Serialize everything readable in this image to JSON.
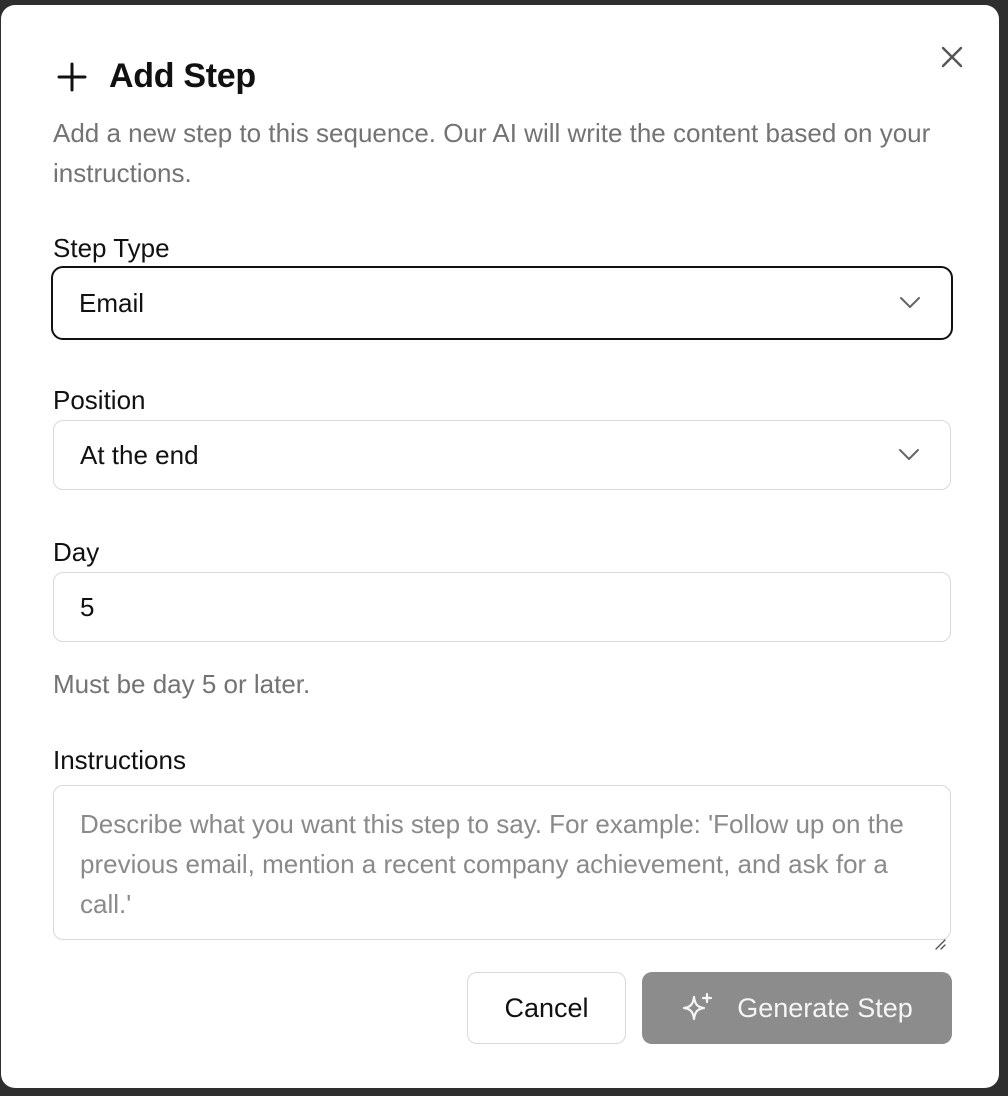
{
  "dialog": {
    "title": "Add Step",
    "description": "Add a new step to this sequence. Our AI will write the content based on your instructions.",
    "header_icon": "plus-icon",
    "close_icon": "close-icon"
  },
  "step_type": {
    "label": "Step Type",
    "value": "Email",
    "icon": "chevron-down-icon"
  },
  "position": {
    "label": "Position",
    "value": "At the end",
    "icon": "chevron-down-icon"
  },
  "day": {
    "label": "Day",
    "value": "5",
    "hint": "Must be day 5 or later."
  },
  "instructions": {
    "label": "Instructions",
    "placeholder": "Describe what you want this step to say. For example: 'Follow up on the previous email, mention a recent company achievement, and ask for a call.'"
  },
  "actions": {
    "cancel_label": "Cancel",
    "generate_label": "Generate Step",
    "generate_icon": "sparkle-icon"
  },
  "colors": {
    "primary_disabled": "#8c8c8c",
    "muted_text": "#737373",
    "border": "#d9d9d9"
  }
}
